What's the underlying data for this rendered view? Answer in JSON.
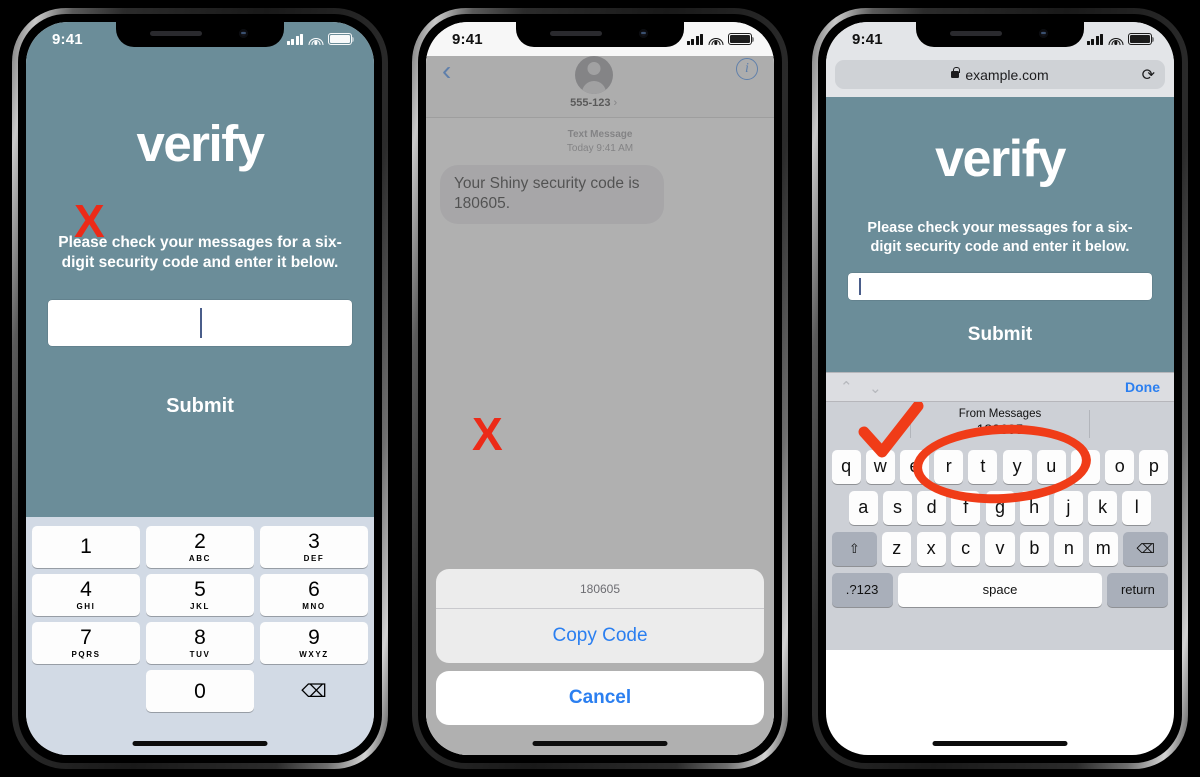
{
  "colors": {
    "teal": "#6b8d99",
    "accent_red": "#f03c18",
    "ios_blue": "#2b7ff0"
  },
  "status_bar": {
    "time": "9:41",
    "signal_icon": "cellular-bars-icon",
    "wifi_icon": "wifi-icon",
    "battery_icon": "battery-icon"
  },
  "phone1": {
    "name": "verify-app-keypad",
    "logo": "verify",
    "instructions": "Please check your messages for a six-digit security code and enter it below.",
    "input_value": "",
    "submit_label": "Submit",
    "annotation": "X",
    "keypad": [
      [
        {
          "num": "1",
          "sub": ""
        },
        {
          "num": "2",
          "sub": "ABC"
        },
        {
          "num": "3",
          "sub": "DEF"
        }
      ],
      [
        {
          "num": "4",
          "sub": "GHI"
        },
        {
          "num": "5",
          "sub": "JKL"
        },
        {
          "num": "6",
          "sub": "MNO"
        }
      ],
      [
        {
          "num": "7",
          "sub": "PQRS"
        },
        {
          "num": "8",
          "sub": "TUV"
        },
        {
          "num": "9",
          "sub": "WXYZ"
        }
      ]
    ],
    "zero_key": "0",
    "delete_key": "⌫"
  },
  "phone2": {
    "name": "messages-app",
    "back_icon": "chevron-left-icon",
    "contact": "555-123",
    "contact_chevron": "›",
    "info_icon": "info-icon",
    "meta_type": "Text Message",
    "meta_time": "Today 9:41 AM",
    "message": "Your Shiny security code is 180605.",
    "annotation": "X",
    "sheet": {
      "title": "180605",
      "copy_label": "Copy Code",
      "cancel_label": "Cancel"
    }
  },
  "phone3": {
    "name": "safari-verify-autofill",
    "url": "example.com",
    "lock_icon": "lock-icon",
    "reload_icon": "reload-icon",
    "logo": "verify",
    "instructions": "Please check your messages for a six-digit security code and enter it below.",
    "input_value": "",
    "submit_label": "Submit",
    "accessory": {
      "prev_icon": "chevron-up-icon",
      "next_icon": "chevron-down-icon",
      "done_label": "Done"
    },
    "autofill": {
      "label": "From Messages",
      "code": "180605"
    },
    "annotation_check": "checkmark",
    "annotation_circle": "red-ellipse-highlight",
    "keyboard": {
      "row1": [
        "q",
        "w",
        "e",
        "r",
        "t",
        "y",
        "u",
        "i",
        "o",
        "p"
      ],
      "row2": [
        "a",
        "s",
        "d",
        "f",
        "g",
        "h",
        "j",
        "k",
        "l"
      ],
      "row3": [
        "z",
        "x",
        "c",
        "v",
        "b",
        "n",
        "m"
      ],
      "shift_icon": "⇧",
      "delete_icon": "⌫",
      "numbers_label": ".?123",
      "space_label": "space",
      "return_label": "return"
    }
  }
}
